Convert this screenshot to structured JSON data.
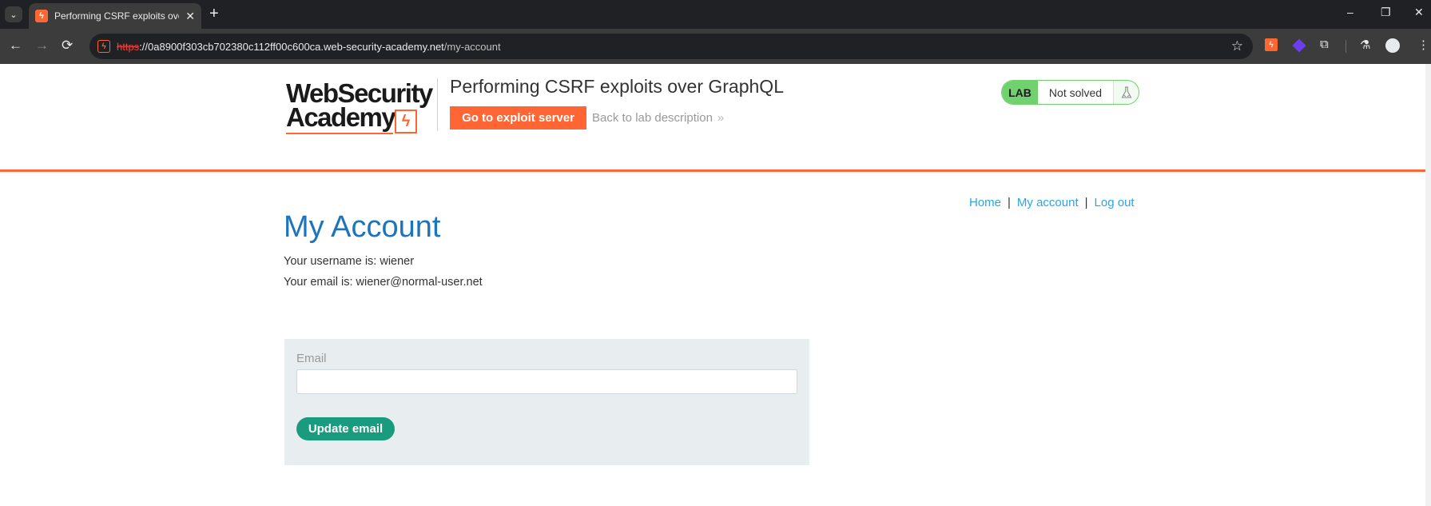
{
  "browser": {
    "tab_menu_icon": "chevron-down-icon",
    "tab": {
      "favicon": "ϟ",
      "title": "Performing CSRF exploits over GraphQL",
      "close": "✕"
    },
    "new_tab": "+",
    "window_controls": {
      "minimize": "–",
      "restore": "❐",
      "close": "✕"
    },
    "nav": {
      "back": "←",
      "forward": "→",
      "reload": "⟳"
    },
    "address_bar": {
      "scheme": "https",
      "host": "://0a8900f303cb702380c112ff00c600ca.web-security-academy.net",
      "path": "/my-account"
    },
    "bookmark": "☆",
    "toolbar_glyphs": {
      "extensions": "⧉",
      "labs": "⚗",
      "menu": "⋮"
    }
  },
  "header": {
    "logo": {
      "line1": "WebSecurity",
      "line2": "Academy",
      "bolt": "ϟ"
    },
    "lab_title": "Performing CSRF exploits over GraphQL",
    "exploit_button": "Go to exploit server",
    "back_link": "Back to lab description",
    "back_link_chevron": "»",
    "status": {
      "badge": "LAB",
      "text": "Not solved",
      "icon": "flask-icon"
    }
  },
  "nav": {
    "home": "Home",
    "sep1": "|",
    "my_account": "My account",
    "sep2": "|",
    "log_out": "Log out"
  },
  "main": {
    "heading": "My Account",
    "username_line": "Your username is: wiener",
    "email_line": "Your email is: wiener@normal-user.net",
    "form": {
      "email_label": "Email",
      "email_value": "",
      "submit_label": "Update email"
    }
  },
  "colors": {
    "accent": "#ff6633",
    "link": "#29a6e5",
    "heading": "#1c75bc",
    "lab_green": "#70d16e",
    "button_green": "#1a9b7e",
    "panel_bg": "#e8eef0"
  }
}
